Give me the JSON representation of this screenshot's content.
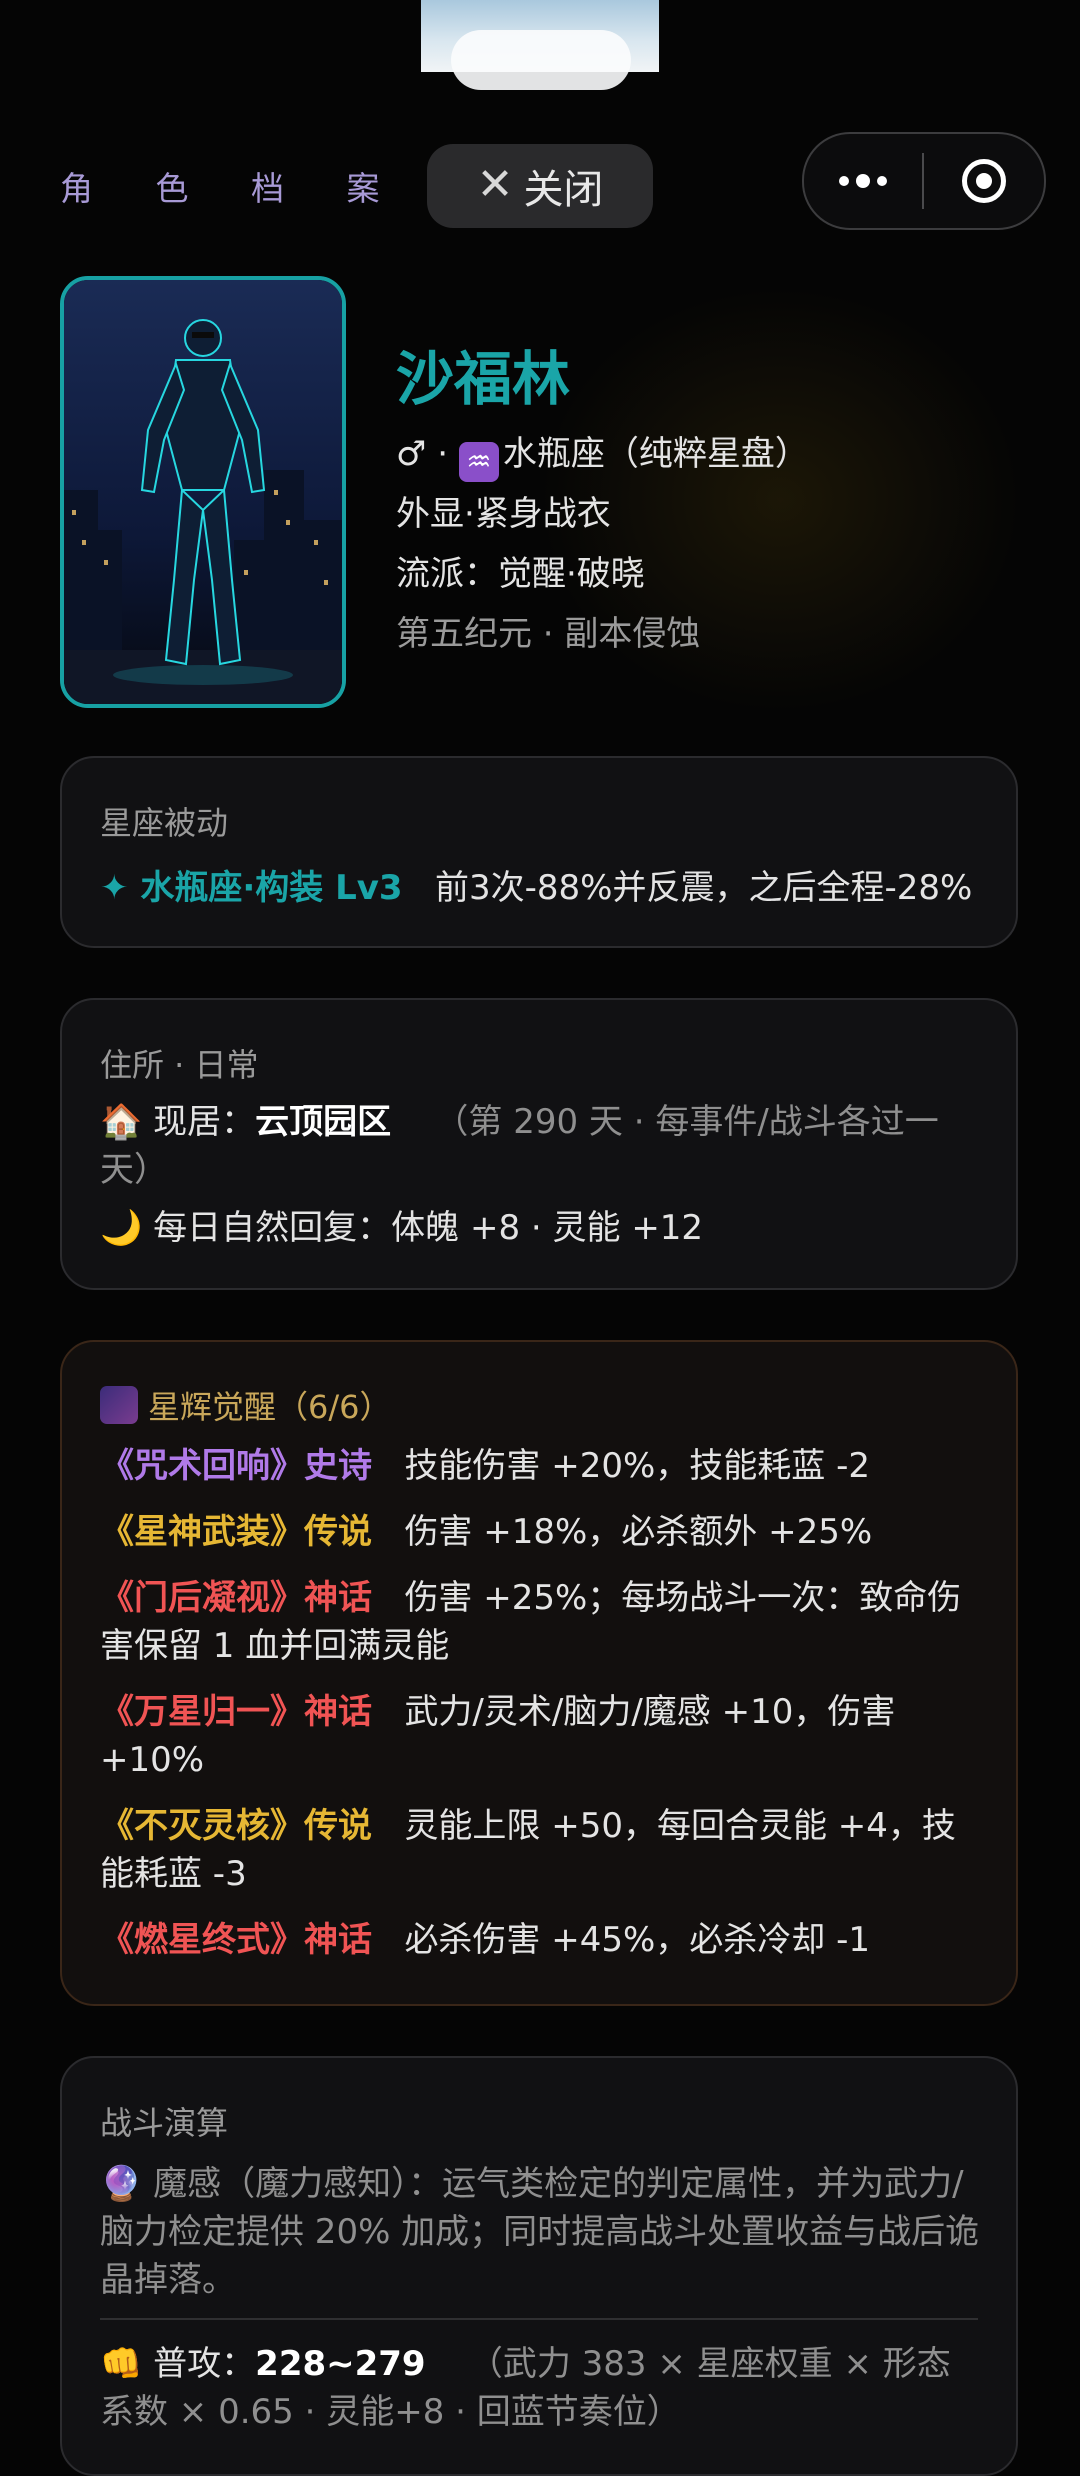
{
  "header": {
    "page_label": "角 色 档 案",
    "close_label": "关闭",
    "close_icon": "close-icon",
    "more_icon": "more-dots-icon",
    "capsule_icon": "target-icon"
  },
  "character": {
    "name": "沙福林",
    "gender_line": "♂ · ",
    "zodiac_symbol": "♒",
    "zodiac_text": "水瓶座（纯粹星盘）",
    "appearance": "外显·紧身战衣",
    "school": "流派：觉醒·破晓",
    "era": "第五纪元 · 副本侵蚀"
  },
  "zodiac_passive": {
    "title": "星座被动",
    "skill_name": "✦ 水瓶座·构装 Lv3",
    "effect": "前3次-88%并反震，之后全程-28%"
  },
  "residence": {
    "title": "住所 · 日常",
    "home_icon": "🏠",
    "home_label": "现居：",
    "home_value": "云顶园区",
    "home_note": "（第 290 天 · 每事件/战斗各过一天）",
    "regen_icon": "🌙",
    "regen_text": "每日自然回复：体魄 +8 · 灵能 +12"
  },
  "awakening": {
    "title": "星辉觉醒（6/6）",
    "items": [
      {
        "name": "《咒术回响》史诗",
        "effect": "技能伤害 +20%，技能耗蓝 -2"
      },
      {
        "name": "《星神武装》传说",
        "effect": "伤害 +18%，必杀额外 +25%"
      },
      {
        "name": "《门后凝视》神话",
        "effect": "伤害 +25%；每场战斗一次：致命伤害保留 1 血并回满灵能"
      },
      {
        "name": "《万星归一》神话",
        "effect": "武力/灵术/脑力/魔感 +10，伤害 +10%"
      },
      {
        "name": "《不灭灵核》传说",
        "effect": "灵能上限 +50，每回合灵能 +4，技能耗蓝 -3"
      },
      {
        "name": "《燃星终式》神话",
        "effect": "必杀伤害 +45%，必杀冷却 -1"
      }
    ]
  },
  "battle": {
    "title": "战斗演算",
    "attr_icon": "🔮",
    "attr_text": "魔感（魔力感知）：运气类检定的判定属性，并为武力/脑力检定提供 20% 加成；同时提高战斗处置收益与战后诡晶掉落。",
    "attack_icon": "👊",
    "attack_label": "普攻：",
    "attack_value": "228~279",
    "attack_note": "（武力 383 × 星座权重 × 形态系数 × 0.65 · 灵能+8 · 回蓝节奏位）"
  }
}
